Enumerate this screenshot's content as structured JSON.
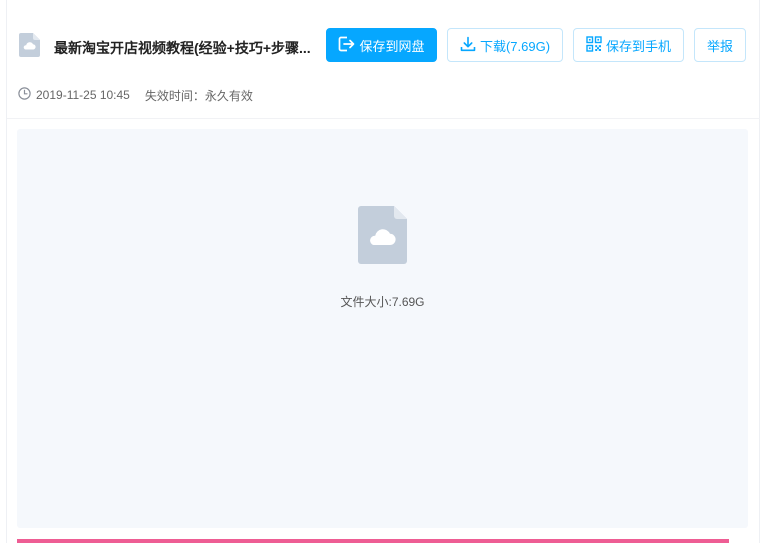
{
  "file": {
    "title": "最新淘宝开店视频教程(经验+技巧+步骤...",
    "date": "2019-11-25 10:45",
    "expire_label": "失效时间：",
    "expire_value": "永久有效",
    "size_label": "文件大小:",
    "size_value": "7.69G"
  },
  "actions": {
    "save_to_disk": "保存到网盘",
    "download": "下载(7.69G)",
    "save_to_phone": "保存到手机",
    "report": "举报"
  },
  "colors": {
    "primary": "#06a7ff",
    "file_icon": "#c3cedb",
    "accent_bar": "#ee5d94"
  },
  "icons": [
    "file-cloud-icon",
    "save-to-disk-icon",
    "download-icon",
    "qr-code-icon",
    "clock-icon"
  ]
}
